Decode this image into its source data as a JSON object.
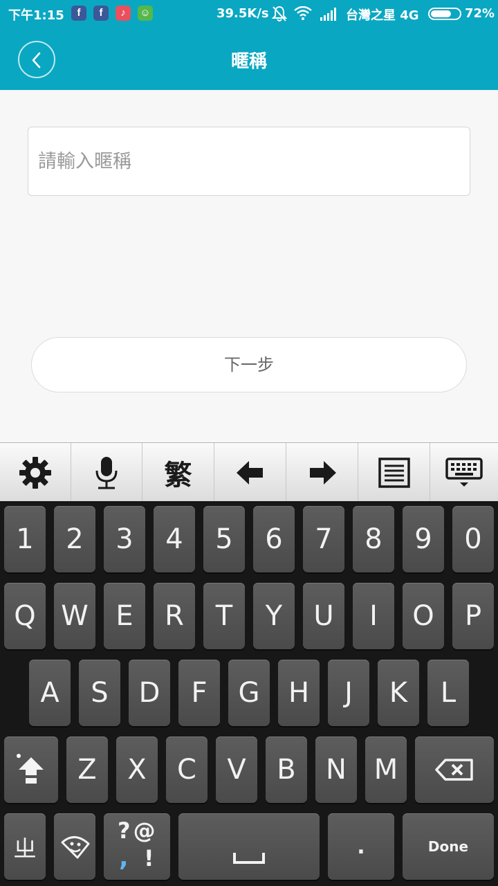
{
  "status_bar": {
    "time": "下午1:15",
    "app_icons": [
      {
        "name": "facebook-icon",
        "glyph": "f",
        "color": "#3b5998"
      },
      {
        "name": "facebook-icon-2",
        "glyph": "f",
        "color": "#3b5998"
      },
      {
        "name": "tiktok-icon",
        "glyph": "♪",
        "color": "#e9505f"
      },
      {
        "name": "app-green-icon",
        "glyph": "☺",
        "color": "#55b84a"
      }
    ],
    "network_speed": "39.5K/s",
    "carrier": "台灣之星 4G",
    "battery_percent": "72%",
    "battery_level": 0.72
  },
  "header": {
    "title": "暱稱"
  },
  "form": {
    "nickname_placeholder": "請輸入暱稱",
    "nickname_value": "",
    "next_label": "下一步"
  },
  "keyboard_toolbar": {
    "traditional_label": "繁",
    "icons": [
      "gear-icon",
      "microphone-icon",
      "traditional-chinese-toggle",
      "arrow-left-icon",
      "arrow-right-icon",
      "notes-icon",
      "keyboard-hide-icon"
    ]
  },
  "keyboard": {
    "number_row": [
      "1",
      "2",
      "3",
      "4",
      "5",
      "6",
      "7",
      "8",
      "9",
      "0"
    ],
    "row_q": [
      "Q",
      "W",
      "E",
      "R",
      "T",
      "Y",
      "U",
      "I",
      "O",
      "P"
    ],
    "row_a": [
      "A",
      "S",
      "D",
      "F",
      "G",
      "H",
      "J",
      "K",
      "L"
    ],
    "row_z": [
      "Z",
      "X",
      "C",
      "V",
      "B",
      "N",
      "M"
    ],
    "symbols_top": "?@",
    "symbols_bottom_comma": ",",
    "symbols_bottom_excl": "!",
    "zhuyin_label": "ㄓ",
    "period_label": ".",
    "done_label": "Done"
  },
  "colors": {
    "header_bg": "#0aa7c2",
    "keyboard_bg": "#171717",
    "key_bg": "#555555"
  }
}
